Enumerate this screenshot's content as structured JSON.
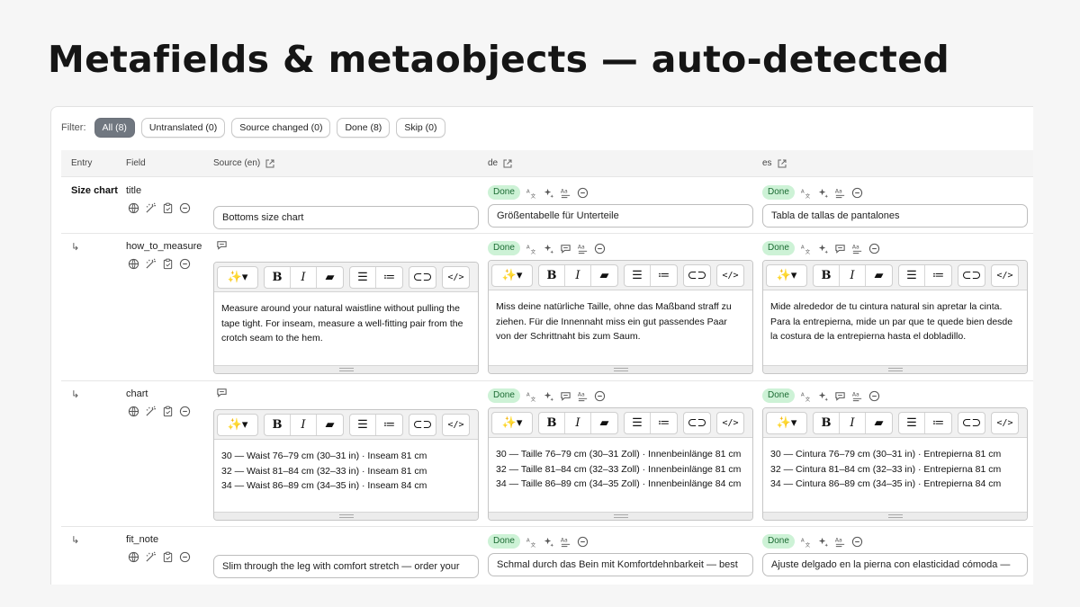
{
  "page_title": "Metafields & metaobjects — auto-detected",
  "filter": {
    "label": "Filter:",
    "chips": [
      {
        "label": "All (8)",
        "active": true
      },
      {
        "label": "Untranslated (0)",
        "active": false
      },
      {
        "label": "Source changed (0)",
        "active": false
      },
      {
        "label": "Done (8)",
        "active": false
      },
      {
        "label": "Skip (0)",
        "active": false
      }
    ]
  },
  "columns": {
    "entry": "Entry",
    "field": "Field",
    "source": "Source (en)",
    "de": "de",
    "es": "es"
  },
  "status_label": "Done",
  "sub_arrow": "↳",
  "rows": [
    {
      "entry": "Size chart",
      "field": "title",
      "type": "single",
      "source": "Bottoms size chart",
      "de": "Größentabelle für Unterteile",
      "es": "Tabla de tallas de pantalones"
    },
    {
      "entry": "",
      "field": "how_to_measure",
      "type": "richtext",
      "source_lines": [
        "Measure around your natural waistline without pulling the",
        "tape tight. For inseam, measure a well-fitting pair from the",
        "crotch seam to the hem."
      ],
      "de_lines": [
        "Miss deine natürliche Taille, ohne das Maßband straff zu",
        "ziehen. Für die Innennaht miss ein gut passendes Paar",
        "von der Schrittnaht bis zum Saum."
      ],
      "es_lines": [
        "Mide alrededor de tu cintura natural sin apretar la cinta.",
        "Para la entrepierna, mide un par que te quede bien desde",
        "la costura de la entrepierna hasta el dobladillo."
      ]
    },
    {
      "entry": "",
      "field": "chart",
      "type": "richtext",
      "source_lines": [
        "30 — Waist 76–79 cm (30–31 in) · Inseam 81 cm",
        "32 — Waist 81–84 cm (32–33 in) · Inseam 81 cm",
        "34 — Waist 86–89 cm (34–35 in) · Inseam 84 cm"
      ],
      "de_lines": [
        "30 — Taille 76–79 cm (30–31 Zoll) · Innenbeinlänge 81 cm",
        "32 — Taille 81–84 cm (32–33 Zoll) · Innenbeinlänge 81 cm",
        "34 — Taille 86–89 cm (34–35 Zoll) · Innenbeinlänge 84 cm"
      ],
      "es_lines": [
        "30 — Cintura 76–79 cm (30–31 in) · Entrepierna 81 cm",
        "32 — Cintura 81–84 cm (32–33 in) · Entrepierna 81 cm",
        "34 — Cintura 86–89 cm (34–35 in) · Entrepierna 84 cm"
      ]
    },
    {
      "entry": "",
      "field": "fit_note",
      "type": "single",
      "source": "Slim through the leg with comfort stretch — order your",
      "de": "Schmal durch das Bein mit Komfortdehnbarkeit — best",
      "es": "Ajuste delgado en la pierna con elasticidad cómoda —"
    }
  ],
  "icons": {
    "field_actions": [
      "globe-icon",
      "magic-wand-icon",
      "clipboard-icon",
      "minus-circle-icon"
    ],
    "lang_actions": [
      "translate-icon",
      "sparkle-icon",
      "comment-icon",
      "spellcheck-icon",
      "minus-circle-icon"
    ],
    "toolbar": [
      "magic-dropdown-icon",
      "bold-icon",
      "italic-icon",
      "eraser-icon",
      "bullet-list-icon",
      "numbered-list-icon",
      "link-icon",
      "code-icon"
    ]
  },
  "colors": {
    "done_badge_bg": "#cdf2d6",
    "done_badge_text": "#1b6b33",
    "active_chip": "#707780"
  }
}
